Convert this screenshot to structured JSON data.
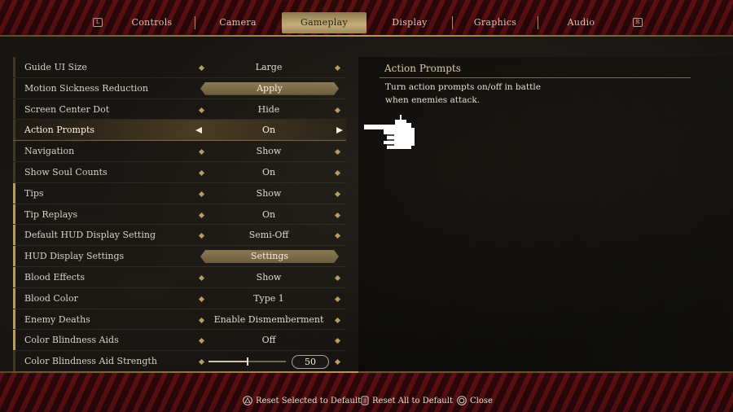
{
  "tabs": {
    "left_bumper": "L",
    "right_bumper": "R",
    "items": [
      {
        "label": "Controls"
      },
      {
        "label": "Camera"
      },
      {
        "label": "Gameplay"
      },
      {
        "label": "Display"
      },
      {
        "label": "Graphics"
      },
      {
        "label": "Audio"
      }
    ],
    "active": "Gameplay"
  },
  "settings": [
    {
      "label": "Guide UI Size",
      "value": "Large"
    },
    {
      "label": "Motion Sickness Reduction",
      "value": "Apply"
    },
    {
      "label": "Screen Center Dot",
      "value": "Hide"
    },
    {
      "label": "Action Prompts",
      "value": "On"
    },
    {
      "label": "Navigation",
      "value": "Show"
    },
    {
      "label": "Show Soul Counts",
      "value": "On"
    },
    {
      "label": "Tips",
      "value": "Show"
    },
    {
      "label": "Tip Replays",
      "value": "On"
    },
    {
      "label": "Default HUD Display Setting",
      "value": "Semi-Off"
    },
    {
      "label": "HUD Display Settings",
      "value": "Settings"
    },
    {
      "label": "Blood Effects",
      "value": "Show"
    },
    {
      "label": "Blood Color",
      "value": "Type 1"
    },
    {
      "label": "Enemy Deaths",
      "value": "Enable Dismemberment"
    },
    {
      "label": "Color Blindness Aids",
      "value": "Off"
    },
    {
      "label": "Color Blindness Aid Strength",
      "value": "50",
      "slider_fraction": 0.5
    }
  ],
  "selected_setting": "Action Prompts",
  "description": {
    "title": "Action Prompts",
    "text": "Turn action prompts on/off in battle when enemies attack."
  },
  "footer": {
    "reset_selected": "Reset Selected to Default",
    "reset_all": "Reset All to Default",
    "close": "Close"
  },
  "colors": {
    "accent_gold": "#b89c62",
    "active_tab": "#c5ad78",
    "border_red": "#3a0a0d"
  },
  "icons": {
    "reset_selected": "triangle-button-icon",
    "reset_all": "touchpad-button-icon",
    "close": "circle-button-icon",
    "cursor": "pointing-hand-icon"
  }
}
